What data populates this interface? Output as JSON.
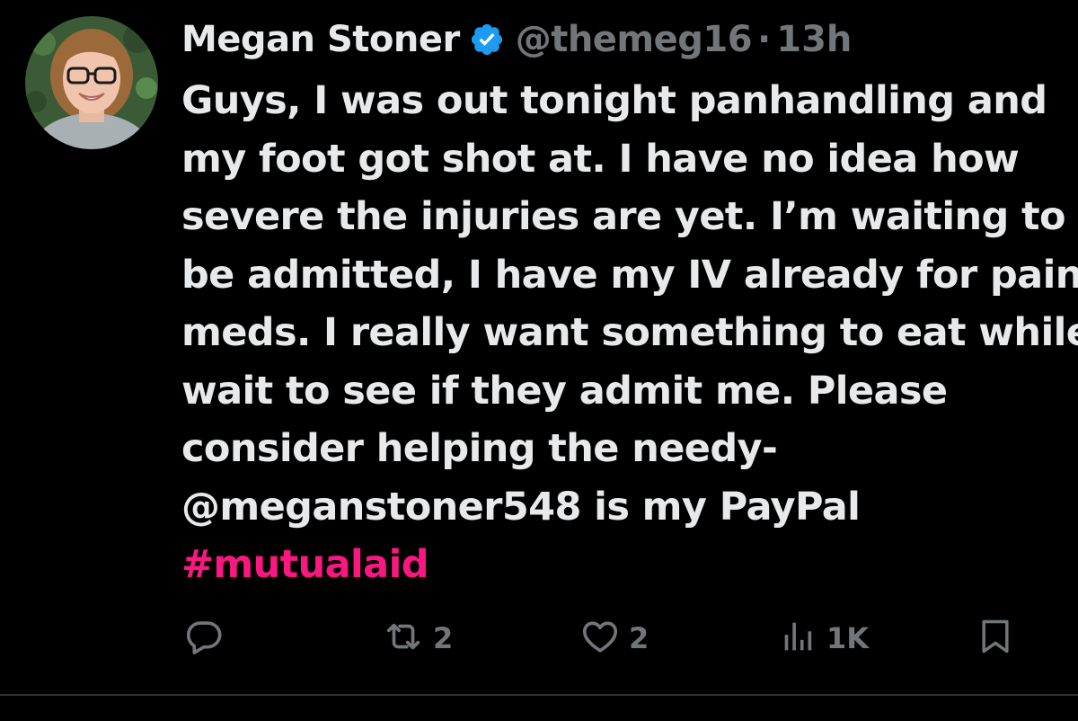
{
  "tweet": {
    "author": {
      "display_name": "Megan Stoner",
      "handle": "@themeg16",
      "separator": "·",
      "time": "13h",
      "verified_icon": "verified-badge-icon"
    },
    "text_lines": [
      "Guys, I was out tonight panhandling and",
      "my foot got shot at. I have no idea how",
      "severe the injuries are yet. I’m waiting to",
      "be admitted, I have my IV already for pain",
      "meds. I really want something to eat while I",
      "wait to see if they admit me. Please",
      "consider helping the needy-",
      "@meganstoner548 is my PayPal"
    ],
    "hashtag": "#mutualaid",
    "actions": {
      "reply": {
        "icon": "reply-icon",
        "count": ""
      },
      "retweet": {
        "icon": "retweet-icon",
        "count": "2"
      },
      "like": {
        "icon": "heart-icon",
        "count": "2"
      },
      "views": {
        "icon": "views-icon",
        "count": "1K"
      },
      "bookmark": {
        "icon": "bookmark-icon",
        "count": ""
      }
    }
  },
  "colors": {
    "background": "#000000",
    "primary_text": "#e7e9ea",
    "secondary_text": "#71767b",
    "hashtag": "#f91880",
    "verified": "#1d9bf0",
    "divider": "#2f3336"
  }
}
